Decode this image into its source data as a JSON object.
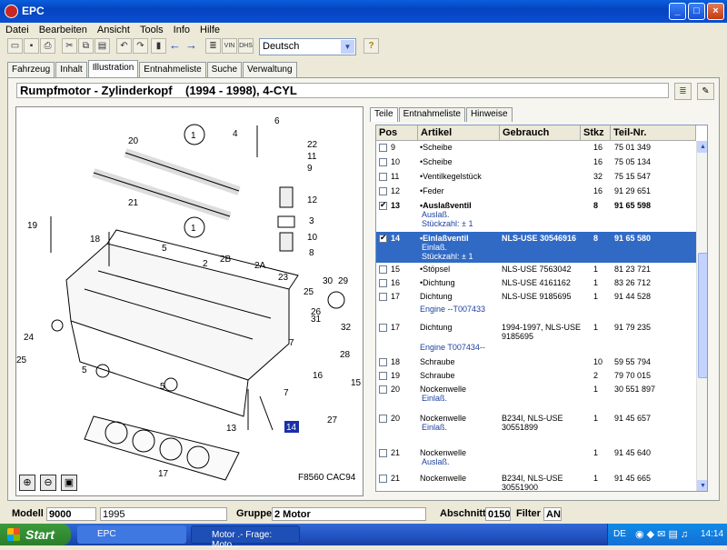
{
  "window": {
    "title": "EPC"
  },
  "menu": [
    "Datei",
    "Bearbeiten",
    "Ansicht",
    "Tools",
    "Info",
    "Hilfe"
  ],
  "toolbar": {
    "language": "Deutsch",
    "vin": "VIN",
    "dhs": "DHS"
  },
  "tabs": [
    "Fahrzeug",
    "Inhalt",
    "Illustration",
    "Entnahmeliste",
    "Suche",
    "Verwaltung"
  ],
  "header": {
    "title": "Rumpfmotor - Zylinderkopf    (1994 - 1998), 4-CYL"
  },
  "parts_tabs": [
    "Teile",
    "Entnahmeliste",
    "Hinweise"
  ],
  "columns": [
    "Pos",
    "Artikel",
    "Gebrauch",
    "Stkz",
    "Teil-Nr."
  ],
  "rows": [
    {
      "pos": "9",
      "artikel": "•Scheibe",
      "gebrauch": "",
      "stkz": "16",
      "teil": "75 01 349"
    },
    {
      "pos": "10",
      "artikel": "•Scheibe",
      "gebrauch": "",
      "stkz": "16",
      "teil": "75 05 134"
    },
    {
      "pos": "11",
      "artikel": "•Ventilkegelstück",
      "gebrauch": "",
      "stkz": "32",
      "teil": "75 15 547"
    },
    {
      "pos": "12",
      "artikel": "•Feder",
      "gebrauch": "",
      "stkz": "16",
      "teil": "91 29 651"
    },
    {
      "pos": "13",
      "artikel": "•Auslaßventil",
      "gebrauch": "",
      "stkz": "8",
      "teil": "91 65 598",
      "sub1": "Auslaß.",
      "sub2": "Stückzahl: ± 1"
    },
    {
      "pos": "14",
      "artikel": "•Einlaßventil",
      "gebrauch": "NLS-USE  30546916",
      "stkz": "8",
      "teil": "91 65 580",
      "sub1": "Einlaß.",
      "sub2": "Stückzahl: ± 1"
    },
    {
      "pos": "15",
      "artikel": "•Stöpsel",
      "gebrauch": "NLS-USE 7563042",
      "stkz": "1",
      "teil": "81 23 721"
    },
    {
      "pos": "16",
      "artikel": "•Dichtung",
      "gebrauch": "NLS-USE 4161162",
      "stkz": "1",
      "teil": "83 26 712"
    },
    {
      "pos": "17",
      "artikel": "Dichtung",
      "gebrauch": "NLS-USE 9185695",
      "stkz": "1",
      "teil": "91 44 528",
      "engine": "Engine --T007433"
    },
    {
      "pos": "17",
      "artikel": "Dichtung",
      "gebrauch": "1994-1997, NLS-USE",
      "gebrauch2": "9185695",
      "stkz": "1",
      "teil": "91 79 235",
      "engine": "Engine T007434--"
    },
    {
      "pos": "18",
      "artikel": "Schraube",
      "gebrauch": "",
      "stkz": "10",
      "teil": "59 55 794"
    },
    {
      "pos": "19",
      "artikel": "Schraube",
      "gebrauch": "",
      "stkz": "2",
      "teil": "79 70 015"
    },
    {
      "pos": "20",
      "artikel": "Nockenwelle",
      "gebrauch": "",
      "stkz": "1",
      "teil": "30 551 897",
      "sub1": "Einlaß."
    },
    {
      "pos": "20",
      "artikel": "Nockenwelle",
      "gebrauch": "B234I, NLS-USE",
      "gebrauch2": "30551899",
      "stkz": "1",
      "teil": "91 45 657",
      "sub1": "Einlaß."
    },
    {
      "pos": "21",
      "artikel": "Nockenwelle",
      "gebrauch": "",
      "stkz": "1",
      "teil": "91 45 640",
      "sub1": "Auslaß."
    },
    {
      "pos": "21",
      "artikel": "Nockenwelle",
      "gebrauch": "B234I, NLS-USE",
      "gebrauch2": "30551900",
      "stkz": "1",
      "teil": "91 45 665"
    }
  ],
  "illustration": {
    "callouts": [
      "1",
      "1",
      "2",
      "2A",
      "2B",
      "3",
      "4",
      "5",
      "5",
      "5",
      "6",
      "7",
      "7",
      "8",
      "9",
      "10",
      "11",
      "12",
      "13",
      "14",
      "15",
      "16",
      "17",
      "18",
      "19",
      "20",
      "21",
      "22",
      "23",
      "24",
      "25",
      "25",
      "26",
      "27",
      "28",
      "29",
      "30",
      "31",
      "32"
    ],
    "ref": "F8560  CAC94"
  },
  "status": {
    "modell_label": "Modell",
    "modell": "9000",
    "year": "1995",
    "gruppe_label": "Gruppe",
    "gruppe": "2 Motor",
    "abschnitt_label": "Abschnitt",
    "abschnitt": "0150",
    "filter_label": "Filter",
    "filter": "AN"
  },
  "taskbar": {
    "start": "Start",
    "task1": "EPC",
    "task2": "Motor .- Frage: Moto...",
    "lang": "DE",
    "clock": "14:14"
  }
}
